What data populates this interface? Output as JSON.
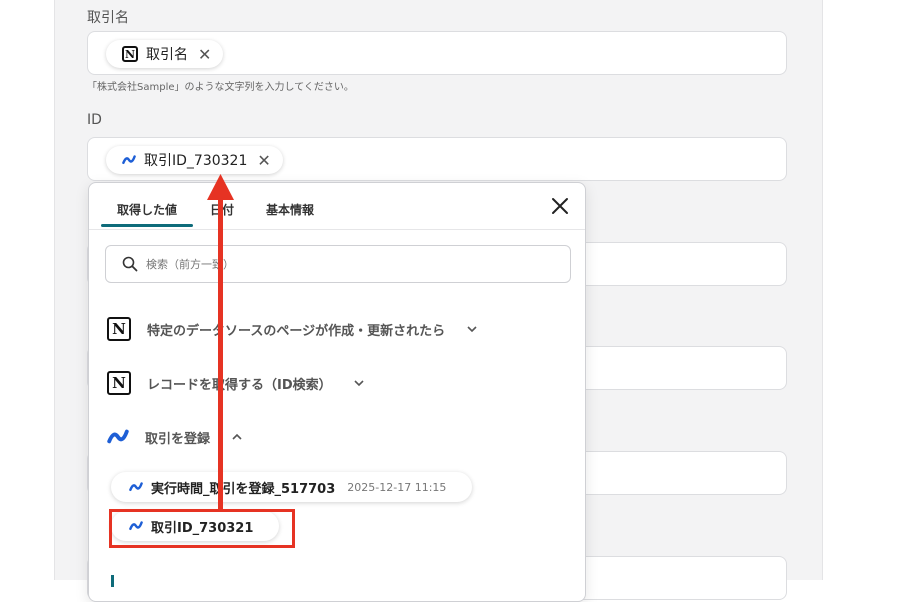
{
  "fields": [
    {
      "label": "取引名",
      "chip": "取引名",
      "chip_icon": "notion-icon",
      "hint": "「株式会社Sample」のような文字列を入力してください。"
    },
    {
      "label": "ID",
      "chip": "取引ID_730321",
      "chip_icon": "moneyforward-icon"
    }
  ],
  "popup": {
    "tabs": [
      "取得した値",
      "日付",
      "基本情報"
    ],
    "active_tab": 0,
    "search_placeholder": "検索（前方一致）",
    "steps": [
      {
        "label": "特定のデータソースのページが作成・更新されたら",
        "icon": "notion-icon",
        "expanded": false
      },
      {
        "label": "レコードを取得する（ID検索）",
        "icon": "notion-icon",
        "expanded": false
      },
      {
        "label": "取引を登録",
        "icon": "moneyforward-icon",
        "expanded": true
      }
    ],
    "values": [
      {
        "label": "実行時間_取引を登録_517703",
        "time": "2025-12-17 11:15"
      },
      {
        "label": "取引ID_730321"
      }
    ]
  },
  "colors": {
    "accent": "#0e6b7a",
    "highlight": "#e63323",
    "mf_blue": "#1e5fd6"
  }
}
